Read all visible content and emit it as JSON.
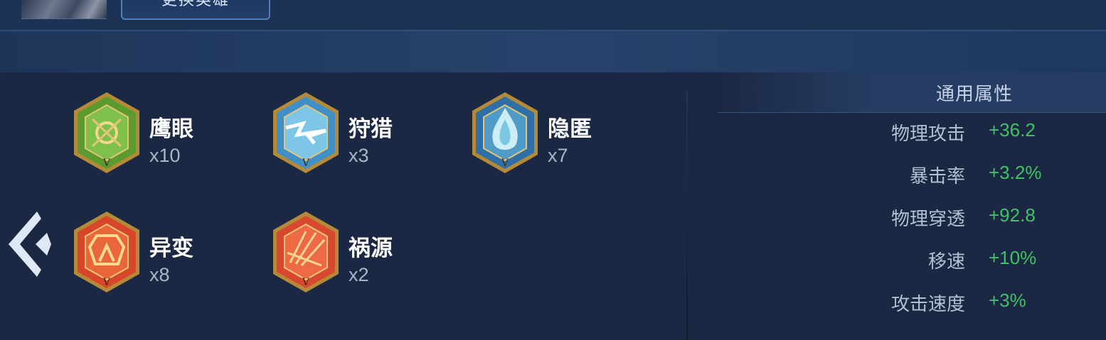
{
  "header": {
    "change_hero_label": "更换英雄"
  },
  "sets": [
    {
      "name": "鹰眼",
      "count": "x10",
      "color": "#5a9a2e",
      "icon": "hawkeye-set-icon"
    },
    {
      "name": "狩猎",
      "count": "x3",
      "color": "#3f8fc8",
      "icon": "hunt-set-icon"
    },
    {
      "name": "隐匿",
      "count": "x7",
      "color": "#2f6fa8",
      "icon": "stealth-set-icon"
    },
    {
      "name": "异变",
      "count": "x8",
      "color": "#d8462a",
      "icon": "mutation-set-icon"
    },
    {
      "name": "祸源",
      "count": "x2",
      "color": "#d8482e",
      "icon": "calamity-set-icon"
    }
  ],
  "stats": {
    "title": "通用属性",
    "rows": [
      {
        "label": "物理攻击",
        "value": "+36.2"
      },
      {
        "label": "暴击率",
        "value": "+3.2%"
      },
      {
        "label": "物理穿透",
        "value": "+92.8"
      },
      {
        "label": "移速",
        "value": "+10%"
      },
      {
        "label": "攻击速度",
        "value": "+3%"
      }
    ],
    "value_color": "#3fc262"
  }
}
